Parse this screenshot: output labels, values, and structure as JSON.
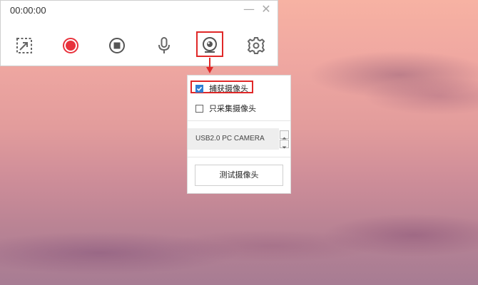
{
  "recorder": {
    "timer": "00:00:00",
    "minimize_glyph": "—",
    "close_glyph": "✕",
    "tools": [
      {
        "icon": "region-select-icon"
      },
      {
        "icon": "record-icon",
        "color": "#e8323c"
      },
      {
        "icon": "stop-icon"
      },
      {
        "icon": "microphone-icon"
      },
      {
        "icon": "webcam-icon"
      },
      {
        "icon": "gear-icon"
      }
    ],
    "highlight_color": "#e02828"
  },
  "camera_menu": {
    "capture_camera": {
      "label": "捕获摄像头",
      "checked": true
    },
    "camera_only": {
      "label": "只采集摄像头",
      "checked": false
    },
    "device": "USB2.0 PC CAMERA",
    "test_button": "测试摄像头",
    "checkbox_color": "#2d7fd4"
  }
}
